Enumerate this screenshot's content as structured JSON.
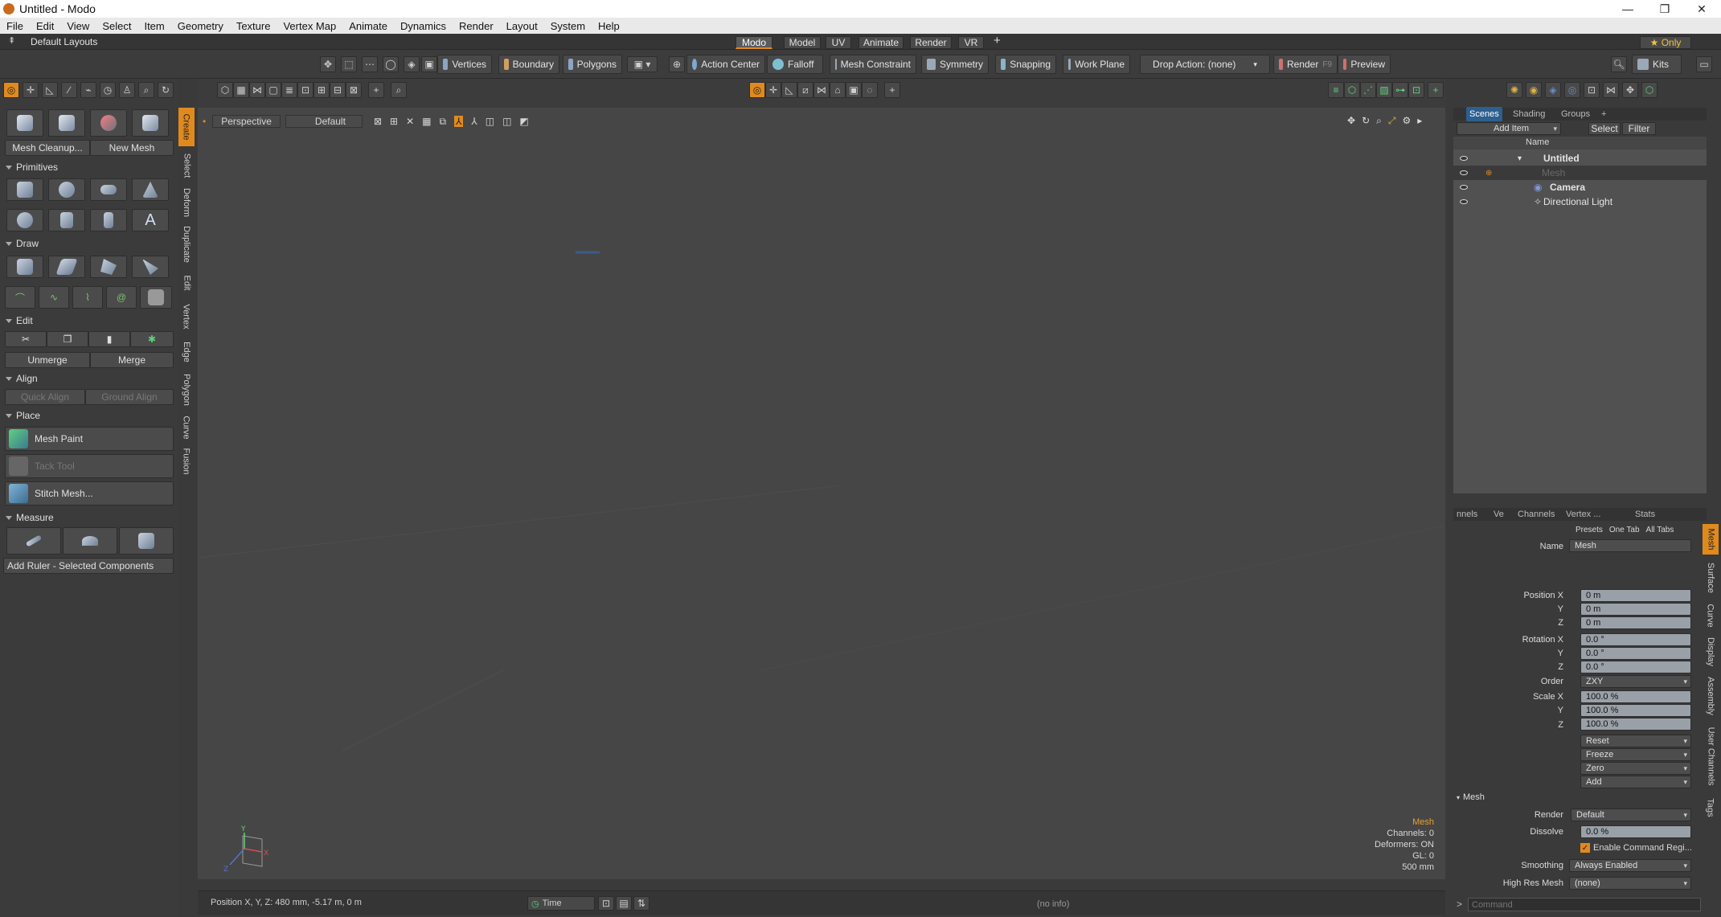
{
  "window": {
    "title": "Untitled - Modo",
    "minimize": "—",
    "restore": "❐",
    "close": "✕"
  },
  "menu": [
    "File",
    "Edit",
    "View",
    "Select",
    "Item",
    "Geometry",
    "Texture",
    "Vertex Map",
    "Animate",
    "Dynamics",
    "Render",
    "Layout",
    "System",
    "Help"
  ],
  "layouts": {
    "label": "Default Layouts",
    "tabs": [
      "Modo",
      "Model",
      "UV",
      "Animate",
      "Render",
      "VR"
    ],
    "active": "Modo",
    "add": "+",
    "only": "★ Only"
  },
  "toolbar": {
    "vertices": "Vertices",
    "boundary": "Boundary",
    "polygons": "Polygons",
    "action_center": "Action Center",
    "falloff": "Falloff",
    "mesh_constraint": "Mesh Constraint",
    "symmetry": "Symmetry",
    "snapping": "Snapping",
    "work_plane": "Work Plane",
    "drop_action": "Drop Action: (none)",
    "render": "Render",
    "render_key": "F9",
    "preview": "Preview",
    "kits": "Kits"
  },
  "left": {
    "vtabs": [
      "Create",
      "Select",
      "Deform",
      "Duplicate",
      "Edit",
      "Vertex",
      "Edge",
      "Polygon",
      "Curve",
      "Fusion"
    ],
    "mesh_cleanup": "Mesh Cleanup...",
    "new_mesh": "New Mesh",
    "primitives": "Primitives",
    "draw": "Draw",
    "edit": "Edit",
    "unmerge": "Unmerge",
    "merge": "Merge",
    "align": "Align",
    "quick_align": "Quick Align",
    "ground_align": "Ground Align",
    "place": "Place",
    "mesh_paint": "Mesh Paint",
    "tack_tool": "Tack Tool",
    "stitch_mesh": "Stitch Mesh...",
    "measure": "Measure",
    "add_ruler": "Add Ruler - Selected Components"
  },
  "viewport": {
    "mode": "Perspective",
    "style": "Default",
    "info": {
      "item": "Mesh",
      "channels": "Channels: 0",
      "deformers": "Deformers: ON",
      "gl": "GL: 0",
      "scale": "500 mm"
    },
    "position": "Position X, Y, Z:  480 mm, -5.17 m, 0 m",
    "time": "Time",
    "noinfo": "(no info)"
  },
  "scenes": {
    "tabs": [
      "Scenes",
      "Shading",
      "Groups"
    ],
    "add": "+",
    "add_item": "Add Item",
    "select": "Select",
    "filter": "Filter",
    "col_name": "Name",
    "items": [
      {
        "name": "Untitled",
        "bold": true
      },
      {
        "name": "Mesh",
        "bold": false
      },
      {
        "name": "Camera",
        "bold": true
      },
      {
        "name": "Directional Light",
        "bold": false
      }
    ]
  },
  "properties": {
    "tabs": [
      "nnels",
      "Ve",
      "Channels",
      "Vertex ...",
      "Stats"
    ],
    "presets": "Presets",
    "one_tab": "One Tab",
    "all_tabs": "All Tabs",
    "name_label": "Name",
    "name_value": "Mesh",
    "position_x": "Position X",
    "y": "Y",
    "z": "Z",
    "pos": [
      "0 m",
      "0 m",
      "0 m"
    ],
    "rotation_x": "Rotation X",
    "rot": [
      "0.0 °",
      "0.0 °",
      "0.0 °"
    ],
    "order_label": "Order",
    "order": "ZXY",
    "scale_x": "Scale X",
    "scale": [
      "100.0 %",
      "100.0 %",
      "100.0 %"
    ],
    "actions": [
      "Reset",
      "Freeze",
      "Zero",
      "Add"
    ],
    "mesh_section": "Mesh",
    "render_label": "Render",
    "render_value": "Default",
    "dissolve_label": "Dissolve",
    "dissolve_value": "0.0 %",
    "enable_cmd": "Enable Command Regi...",
    "smoothing_label": "Smoothing",
    "smoothing_value": "Always Enabled",
    "hires_label": "High Res Mesh",
    "hires_value": "(none)",
    "vtabs": [
      "Mesh",
      "Surface",
      "Curve",
      "Display",
      "Assembly",
      "User Channels",
      "Tags"
    ],
    "command_placeholder": "Command"
  },
  "colors": {
    "accent": "#e08a1e",
    "select_blue": "#2d5f8f"
  }
}
